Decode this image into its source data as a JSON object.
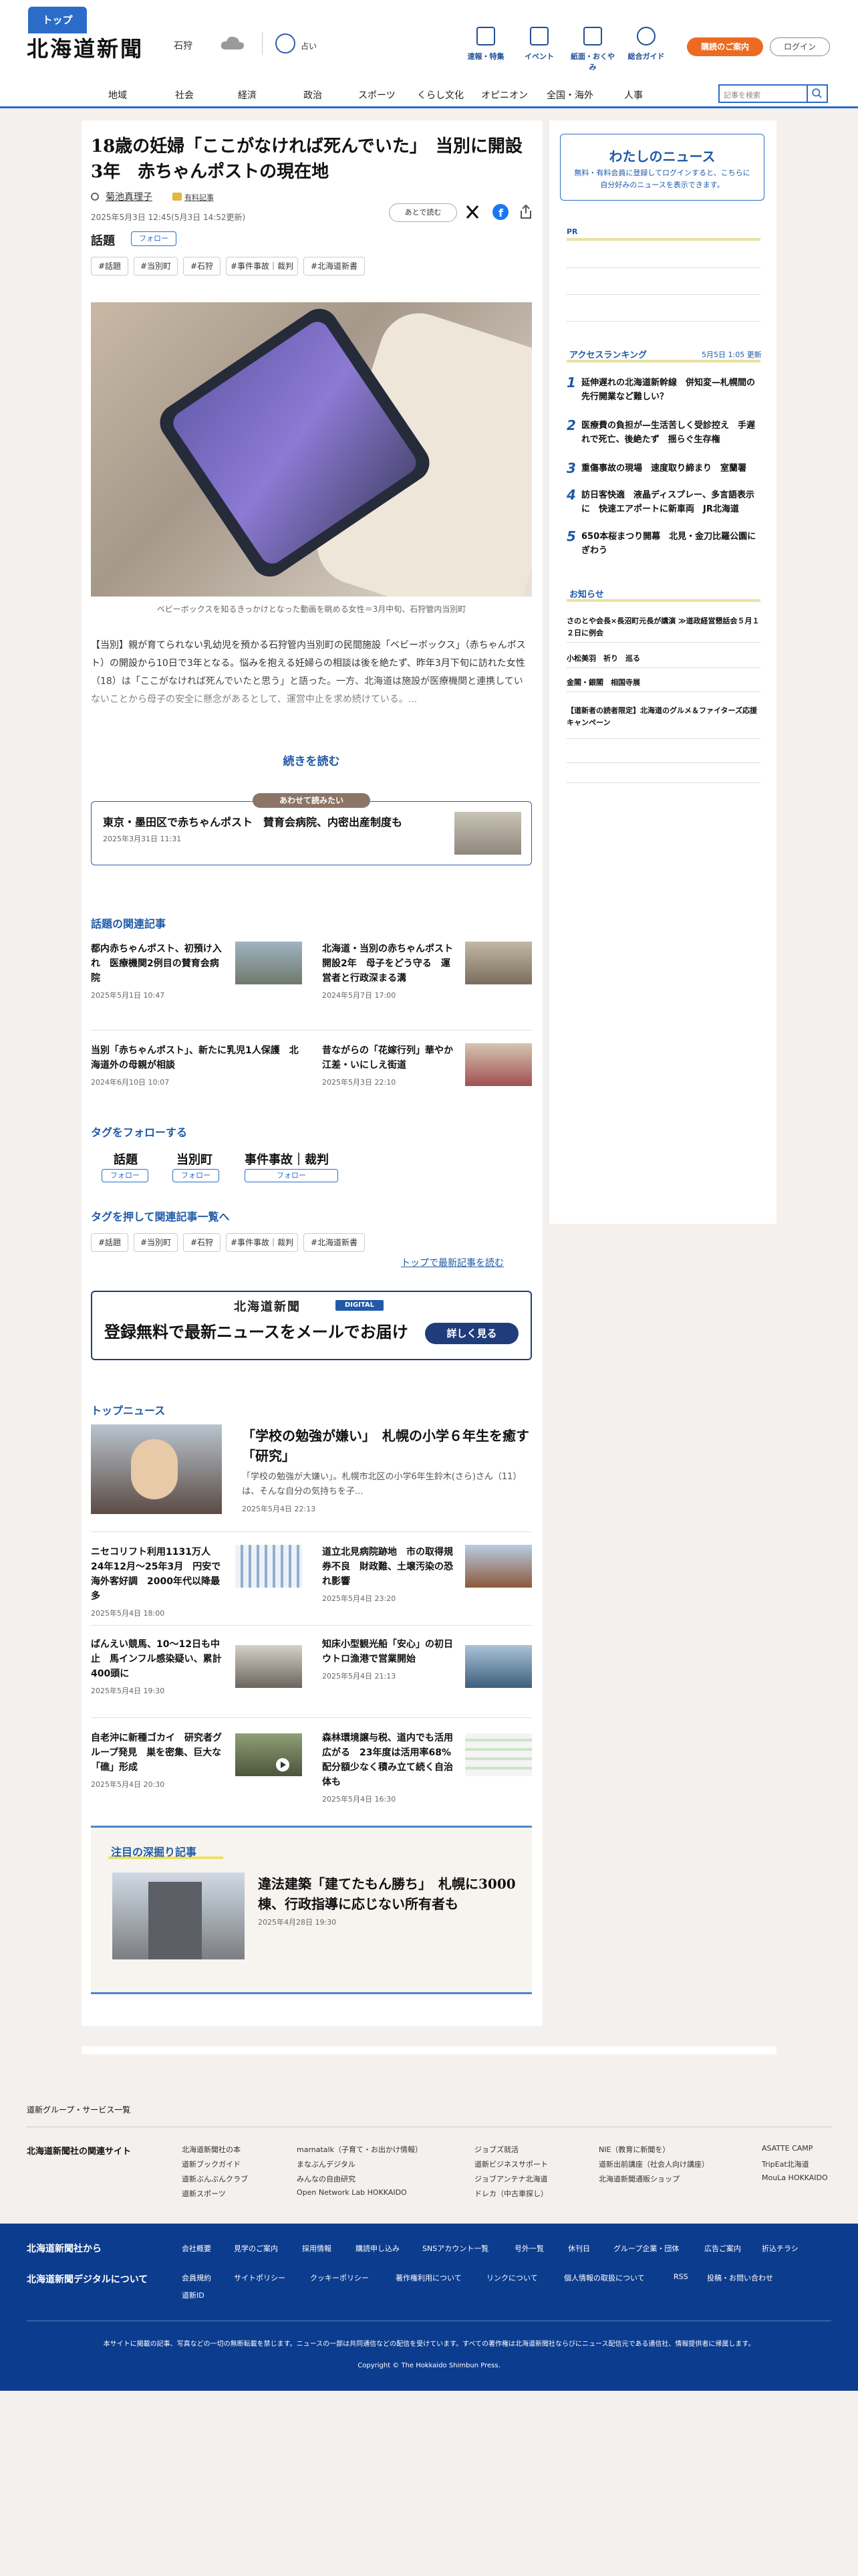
{
  "header": {
    "logo": "北海道新聞",
    "region": "石狩",
    "fortune": "占い",
    "tools": [
      "速報・特集",
      "イベント",
      "紙面・おくやみ",
      "総合ガイド"
    ],
    "guide_button": "購読のご案内",
    "login_button": "ログイン",
    "search_placeholder": "記事を検索"
  },
  "nav": {
    "items": [
      "トップ",
      "地域",
      "社会",
      "経済",
      "政治",
      "スポーツ",
      "くらし文化",
      "オピニオン",
      "全国・海外",
      "人事"
    ]
  },
  "article": {
    "headline": "18歳の妊婦「ここがなければ死んでいた」　当別に開設3年　赤ちゃんポストの現在地",
    "author": "菊池真理子",
    "paid_label": "有料記事",
    "date": "2025年5月3日 12:45(5月3日 14:52更新)",
    "later_button": "あとで読む",
    "topic_label": "話題",
    "follow_label": "フォロー",
    "tags": [
      "#話題",
      "#当別町",
      "#石狩",
      "#事件事故｜裁判",
      "#北海道新書"
    ],
    "photo_caption": "ベビーボックスを知るきっかけとなった動画を眺める女性＝3月中旬、石狩管内当別町",
    "body": "【当別】親が育てられない乳幼児を預かる石狩管内当別町の民間施設「ベビーボックス」（赤ちゃんポスト）の開設から10日で3年となる。悩みを抱える妊婦らの相談は後を絶たず、昨年3月下旬に訪れた女性（18）は「ここがなければ死んでいたと思う」と語った。一方、北海道は施設が医療機関と連携していないことから母子の安全に懸念があるとして、運営中止を求め続けている。...",
    "read_more": "続きを読む",
    "also_read_label": "あわせて読みたい",
    "also_read_title": "東京・墨田区で赤ちゃんポスト　賛育会病院、内密出産制度も",
    "also_read_date": "2025年3月31日 11:31"
  },
  "related": {
    "title": "話題の関連記事",
    "items": [
      {
        "title": "都内赤ちゃんポスト、初預け入れ　医療機関2例目の賛育会病院",
        "date": "2025年5月1日 10:47"
      },
      {
        "title": "北海道・当別の赤ちゃんポスト開設2年　母子をどう守る　運営者と行政深まる溝",
        "date": "2024年5月7日 17:00"
      },
      {
        "title": "当別「赤ちゃんポスト」、新たに乳児1人保護　北海道外の母親が相談",
        "date": "2024年6月10日 10:07"
      },
      {
        "title": "昔ながらの「花嫁行列」華やか　江差・いにしえ街道",
        "date": "2025年5月3日 22:10"
      }
    ]
  },
  "follow_tags": {
    "title": "タグをフォローする",
    "names": [
      "話題",
      "当別町",
      "事件事故｜裁判"
    ],
    "button": "フォロー"
  },
  "tag_list": {
    "title": "タグを押して関連記事一覧へ",
    "tags": [
      "#話題",
      "#当別町",
      "#石狩",
      "#事件事故｜裁判",
      "#北海道新書"
    ],
    "to_latest": "トップで最新記事を読む"
  },
  "banner": {
    "logo": "北海道新聞",
    "badge": "DIGITAL",
    "text": "登録無料で最新ニュースをメールでお届け",
    "button": "詳しく見る"
  },
  "top_news": {
    "title": "トップニュース",
    "lead": {
      "title": "「学校の勉強が嫌い」　札幌の小学６年生を癒す「研究」",
      "summary": "「学校の勉強が大嫌い」。札幌市北区の小学6年生鈴木(さら)さん（11）は、そんな自分の気持ちを子...",
      "date": "2025年5月4日 22:13"
    },
    "items": [
      {
        "title": "ニセコリフト利用1131万人　24年12月〜25年3月　円安で海外客好調　2000年代以降最多",
        "date": "2025年5月4日 18:00"
      },
      {
        "title": "道立北見病院跡地　市の取得規券不良　財政難、土壌汚染の恐れ影響",
        "date": "2025年5月4日 23:20"
      },
      {
        "title": "ばんえい競馬、10〜12日も中止　馬インフル感染疑い、累計400頭に",
        "date": "2025年5月4日 19:30"
      },
      {
        "title": "知床小型観光船「安心」の初日　ウトロ漁港で営業開始",
        "date": "2025年5月4日 21:13"
      },
      {
        "title": "自老沖に新種ゴカイ　研究者グループ発見　巣を密集、巨大な「礁」形成",
        "date": "2025年5月4日 20:30"
      },
      {
        "title": "森林環境譲与税、道内でも活用広がる　23年度は活用率68%　配分額少なく積み立て続く自治体も",
        "date": "2025年5月4日 16:30"
      }
    ]
  },
  "deep": {
    "title": "注目の深掘り記事",
    "headline": "違法建築「建てたもん勝ち」　札幌に3000棟、行政指導に応じない所有者も",
    "date": "2025年4月28日 19:30"
  },
  "sidebar": {
    "mynews_title": "わたしのニュース",
    "mynews_desc": "無料・有料会員に登録してログインすると、こちらに自分好みのニュースを表示できます。",
    "pr": "PR",
    "ranking_title": "アクセスランキング",
    "ranking_time": "5月5日 1:05 更新",
    "ranking": [
      "延伸遅れの北海道新幹線　併知変—札幌間の先行開業など難しい？",
      "医療費の負担が—生活苦しく受診控え　手遅れで死亡、後絶たず　揺らぐ生存権",
      "重傷事故の現場　速度取り締まり　室蘭署",
      "訪日客快適　液晶ディスプレー、多言語表示に　快速エアポートに新車両　JR北海道",
      "650本桜まつり開幕　北見・金刀比羅公園にぎわう"
    ],
    "info_title": "お知らせ",
    "info": [
      "さのとや会長×長沼町元長が講演 ≫道政経営懇話会５月１２日に例会",
      "小松美羽　祈り　巡る",
      "金閣・銀閣　相国寺展",
      "【道新者の読者限定】北海道のグルメ＆ファイターズ応援キャンペーン"
    ]
  },
  "footer": {
    "group_link": "道新グループ・サービス一覧",
    "related_sites_title": "北海道新聞社の関連サイト",
    "sites": [
      [
        "北海道新聞社の本",
        "道新ブックガイド",
        "道新ぶんぶんクラブ",
        "道新スポーツ"
      ],
      [
        "marnatalk（子育て・お出かけ情報）",
        "まなぶんデジタル",
        "みんなの自由研究",
        "Open Network Lab HOKKAIDO"
      ],
      [
        "ジョブズ就活",
        "道新ビジネスサポート",
        "ジョブアンテナ北海道",
        "ドレカ（中古車探し）"
      ],
      [
        "NIE（教育に新聞を）",
        "道新出前講座（社会人向け講座）",
        "北海道新聞通販ショップ"
      ],
      [
        "ASATTE CAMP",
        "TripEat北海道",
        "MouLa HOKKAIDO"
      ]
    ],
    "company_title": "北海道新聞社から",
    "digital_title": "北海道新聞デジタルについて",
    "company_links": [
      "会社概要",
      "見学のご案内",
      "採用情報",
      "購読申し込み",
      "SNSアカウント一覧",
      "号外一覧",
      "休刊日",
      "グループ企業・団体",
      "広告ご案内",
      "折込チラシ"
    ],
    "digital_links": [
      "会員規約",
      "サイトポリシー",
      "クッキーポリシー",
      "著作権利用について",
      "リンクについて",
      "個人情報の取扱について",
      "RSS",
      "投稿・お問い合わせ",
      "道新ID"
    ],
    "note": "本サイトに掲載の記事、写真などの一切の無断転載を禁じます。ニュースの一部は共同通信などの配信を受けています。すべての著作権は北海道新聞社ならびにニュース配信元である通信社、情報提供者に帰属します。",
    "copyright": "Copyright © The Hokkaido Shimbun Press."
  }
}
